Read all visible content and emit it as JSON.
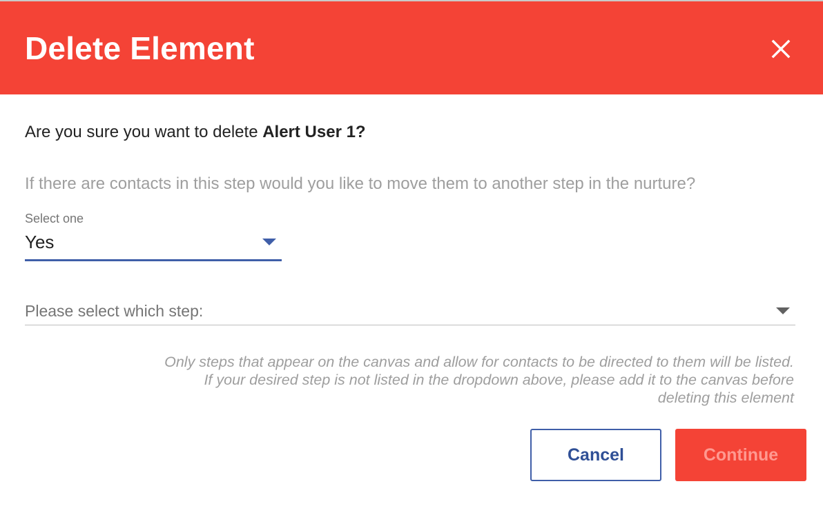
{
  "dialog": {
    "title": "Delete Element",
    "close_icon": "close-icon",
    "header_color": "#f44336"
  },
  "confirm": {
    "prefix": "Are you sure you want to delete ",
    "element_name": "Alert User 1?"
  },
  "question": "If there are contacts in this step would you like to move them to another step in the nurture?",
  "move_select": {
    "label": "Select one",
    "value": "Yes",
    "icon": "caret-down-icon",
    "accent_color": "#3f5ea8"
  },
  "step_select": {
    "placeholder": "Please select which step:",
    "icon": "caret-down-icon"
  },
  "note": {
    "line1": "Only steps that appear on the canvas and allow for contacts to be directed to them will be listed.",
    "line2": "If your desired step is not listed in the dropdown above, please add it to the canvas before",
    "line3": "deleting this element"
  },
  "buttons": {
    "cancel_label": "Cancel",
    "continue_label": "Continue"
  }
}
